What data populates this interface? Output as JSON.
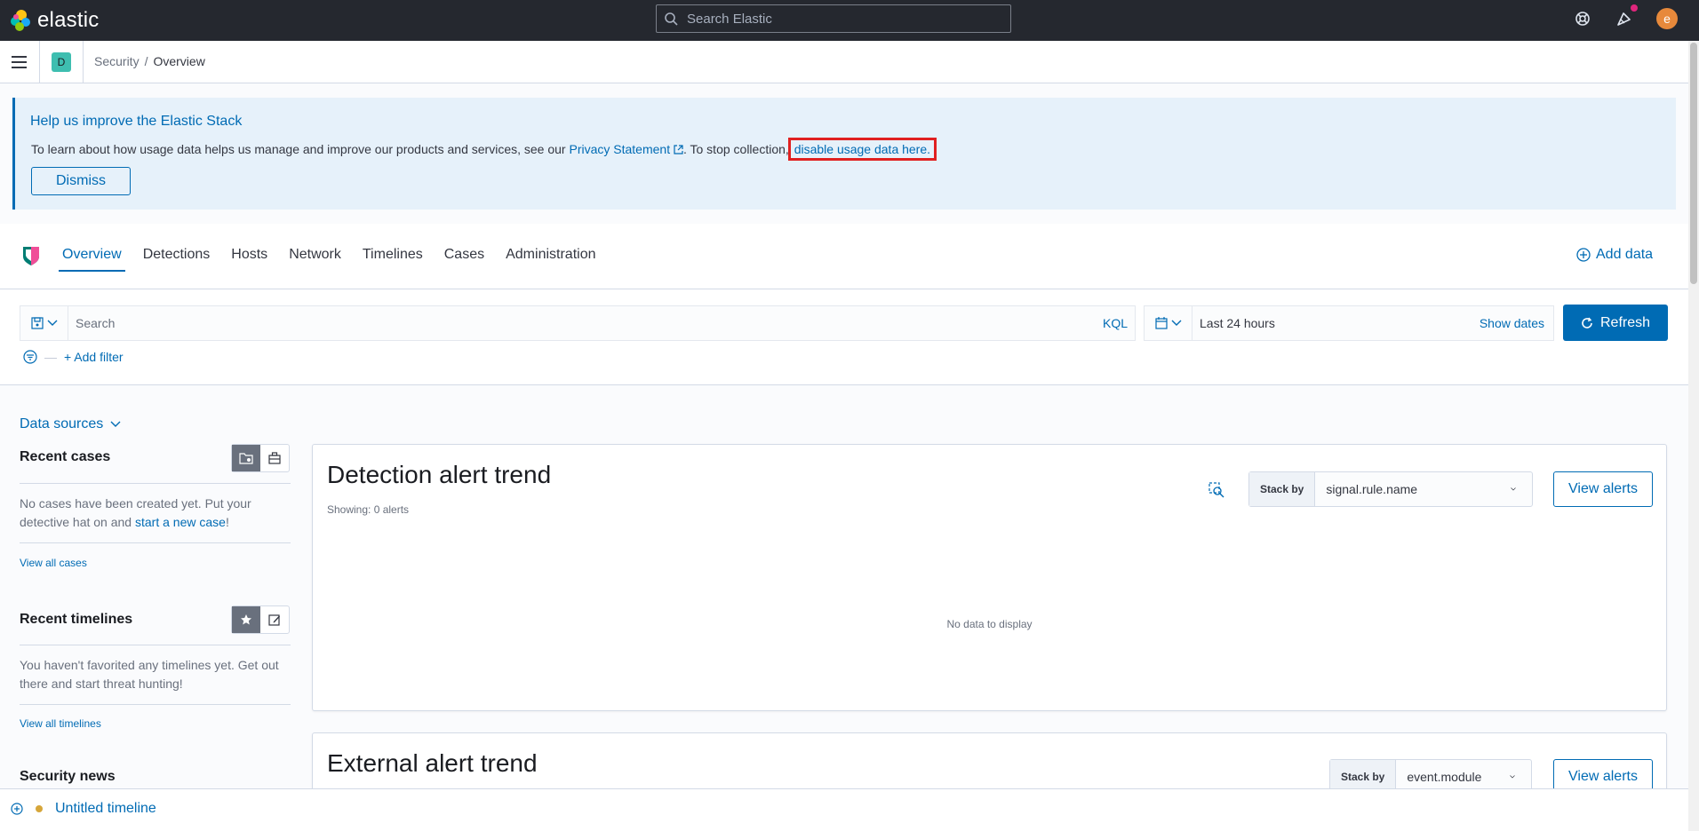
{
  "header": {
    "brand": "elastic",
    "search_placeholder": "Search Elastic",
    "avatar_initial": "e"
  },
  "breadcrumbs": {
    "space_initial": "D",
    "items": [
      "Security",
      "Overview"
    ]
  },
  "callout": {
    "title": "Help us improve the Elastic Stack",
    "body_prefix": "To learn about how usage data helps us manage and improve our products and services, see our ",
    "privacy_link": "Privacy Statement",
    "body_middle": ". To stop collection, ",
    "disable_link": "disable usage data here.",
    "dismiss_label": "Dismiss"
  },
  "app_nav": {
    "tabs": [
      "Overview",
      "Detections",
      "Hosts",
      "Network",
      "Timelines",
      "Cases",
      "Administration"
    ],
    "active_tab": "Overview",
    "add_data_label": "Add data"
  },
  "query_bar": {
    "search_placeholder": "Search",
    "language_label": "KQL",
    "time_range": "Last 24 hours",
    "show_dates_label": "Show dates",
    "refresh_label": "Refresh",
    "add_filter_label": "+ Add filter"
  },
  "sidebar": {
    "data_sources_label": "Data sources",
    "recent_cases": {
      "title": "Recent cases",
      "empty_text": "No cases have been created yet. Put your detective hat on and ",
      "link_text": "start a new case",
      "empty_suffix": "!",
      "view_all": "View all cases"
    },
    "recent_timelines": {
      "title": "Recent timelines",
      "empty_text": "You haven't favorited any timelines yet. Get out there and start threat hunting!",
      "view_all": "View all timelines"
    },
    "security_news_title": "Security news"
  },
  "detection_panel": {
    "title": "Detection alert trend",
    "subtitle": "Showing: 0 alerts",
    "stack_by_label": "Stack by",
    "stack_by_value": "signal.rule.name",
    "view_alerts_label": "View alerts",
    "empty_text": "No data to display"
  },
  "external_panel": {
    "title": "External alert trend",
    "stack_by_label": "Stack by",
    "stack_by_value": "event.module",
    "view_alerts_label": "View alerts"
  },
  "timeline_bar": {
    "label": "Untitled timeline"
  },
  "colors": {
    "accent": "#006bb4",
    "header_bg": "#25282f",
    "callout_bg": "#e6f1fa",
    "highlight": "#e02020"
  }
}
